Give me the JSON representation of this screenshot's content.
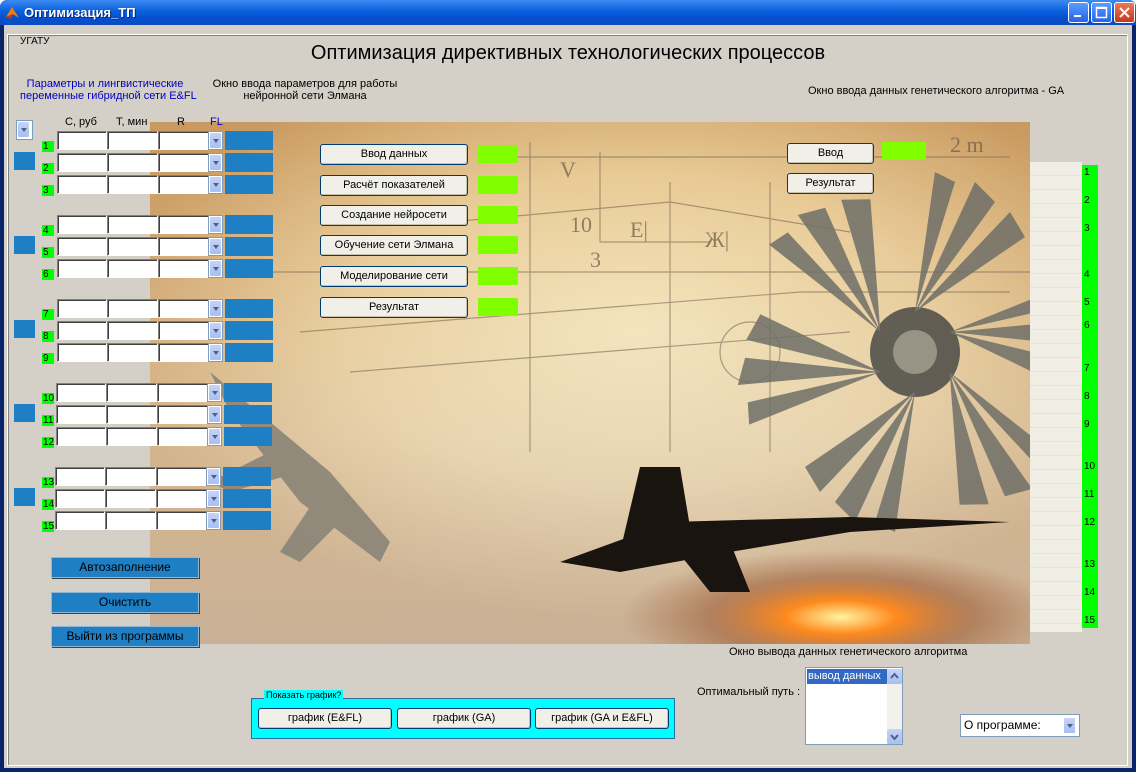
{
  "window": {
    "title": "Оптимизация_ТП"
  },
  "panel": {
    "label": "УГАТУ"
  },
  "main_title": "Оптимизация директивных технологических процессов",
  "left_header": {
    "line1": "Параметры и лингвистические",
    "line2": "переменные гибридной сети E&FL"
  },
  "mid_header": {
    "line1": "Окно ввода параметров для работы",
    "line2": "нейронной сети Элмана"
  },
  "ga_header": "Окно ввода данных генетического алгоритма - GA",
  "columns": {
    "c": "С, руб",
    "t": "Т, мин",
    "r": "R",
    "fl": "FL"
  },
  "row_numbers": [
    "1",
    "2",
    "3",
    "4",
    "5",
    "6",
    "7",
    "8",
    "9",
    "10",
    "11",
    "12",
    "13",
    "14",
    "15"
  ],
  "nn_buttons": [
    "Ввод данных",
    "Расчёт показателей",
    "Создание нейросети",
    "Обучение сети Элмана",
    "Моделирование сети",
    "Результат"
  ],
  "ga_buttons": {
    "input": "Ввод",
    "result": "Результат"
  },
  "ga_numbers": [
    "1",
    "2",
    "3",
    "4",
    "5",
    "6",
    "7",
    "8",
    "9",
    "10",
    "11",
    "12",
    "13",
    "14",
    "15"
  ],
  "action_buttons": [
    "Автозаполнение",
    "Очистить",
    "Выйти из программы"
  ],
  "graph_panel": {
    "label": "Показать график?",
    "buttons": [
      "график (E&FL)",
      "график (GA)",
      "график  (GA и E&FL)"
    ]
  },
  "output": {
    "title": "Окно вывода данных генетического алгоритма",
    "path_label": "Оптимальный путь :",
    "list_item": "вывод данных"
  },
  "about": {
    "value": "О программе:"
  },
  "colors": {
    "green": "#00ff00",
    "indicator": "#80ff00",
    "blue": "#1e7fc4",
    "titlebar": "#0a5fdc"
  }
}
